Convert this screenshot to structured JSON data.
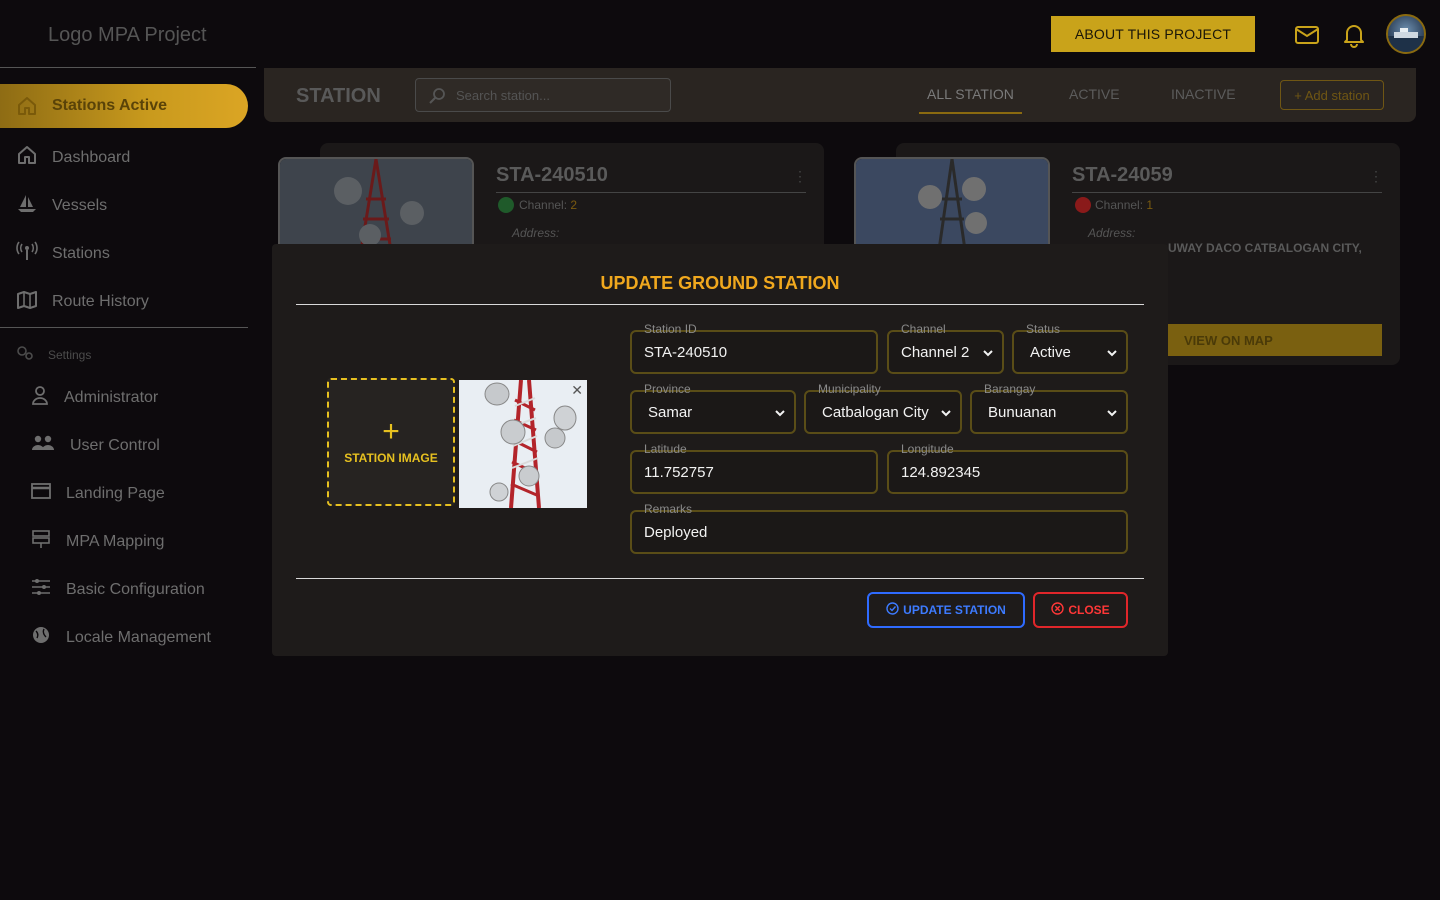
{
  "app": {
    "logo_text": "Logo MPA Project",
    "about_label": "ABOUT THIS PROJECT"
  },
  "sidebar": {
    "active_label": "Stations Active",
    "items": [
      {
        "label": "Dashboard",
        "icon": "home-icon"
      },
      {
        "label": "Vessels",
        "icon": "sailboat-icon"
      },
      {
        "label": "Stations",
        "icon": "antenna-icon"
      },
      {
        "label": "Route History",
        "icon": "map-icon"
      }
    ],
    "settings_label": "Settings",
    "settings_items": [
      {
        "label": "Administrator",
        "icon": "user-icon"
      },
      {
        "label": "User Control",
        "icon": "users-icon"
      },
      {
        "label": "Landing Page",
        "icon": "window-icon"
      },
      {
        "label": "MPA Mapping",
        "icon": "sign-icon"
      },
      {
        "label": "Basic Configuration",
        "icon": "sliders-icon"
      },
      {
        "label": "Locale Management",
        "icon": "globe-icon"
      }
    ]
  },
  "station_bar": {
    "title": "STATION",
    "search_placeholder": "Search station...",
    "tabs": [
      "ALL STATION",
      "ACTIVE",
      "INACTIVE"
    ],
    "active_tab": "ALL STATION",
    "add_label": "+ Add station"
  },
  "cards": [
    {
      "id": "STA-240510",
      "channel_label": "Channel:",
      "channel": "2",
      "status_color": "#1f8a3a",
      "address_label": "Address:"
    },
    {
      "id": "STA-24059",
      "channel_label": "Channel:",
      "channel": "1",
      "status_color": "#c42020",
      "address_label": "Address:",
      "address_partial": "UWAY DACO CATBALOGAN CITY,",
      "view_map_label": "VIEW ON MAP"
    }
  ],
  "modal": {
    "title": "UPDATE GROUND STATION",
    "image_label": "STATION IMAGE",
    "fields": {
      "station_id": {
        "label": "Station ID",
        "value": "STA-240510"
      },
      "channel": {
        "label": "Channel",
        "value": "Channel 2"
      },
      "status": {
        "label": "Status",
        "value": "Active"
      },
      "province": {
        "label": "Province",
        "value": "Samar"
      },
      "municipality": {
        "label": "Municipality",
        "value": "Catbalogan City"
      },
      "barangay": {
        "label": "Barangay",
        "value": "Bunuanan"
      },
      "latitude": {
        "label": "Latitude",
        "value": "11.752757"
      },
      "longitude": {
        "label": "Longitude",
        "value": "124.892345"
      },
      "remarks": {
        "label": "Remarks",
        "value": "Deployed"
      }
    },
    "update_label": "UPDATE STATION",
    "close_label": "CLOSE"
  },
  "colors": {
    "accent": "#c9a31a",
    "modal_title": "#f0a81e",
    "update_blue": "#2f6bff",
    "close_red": "#e0262a"
  }
}
